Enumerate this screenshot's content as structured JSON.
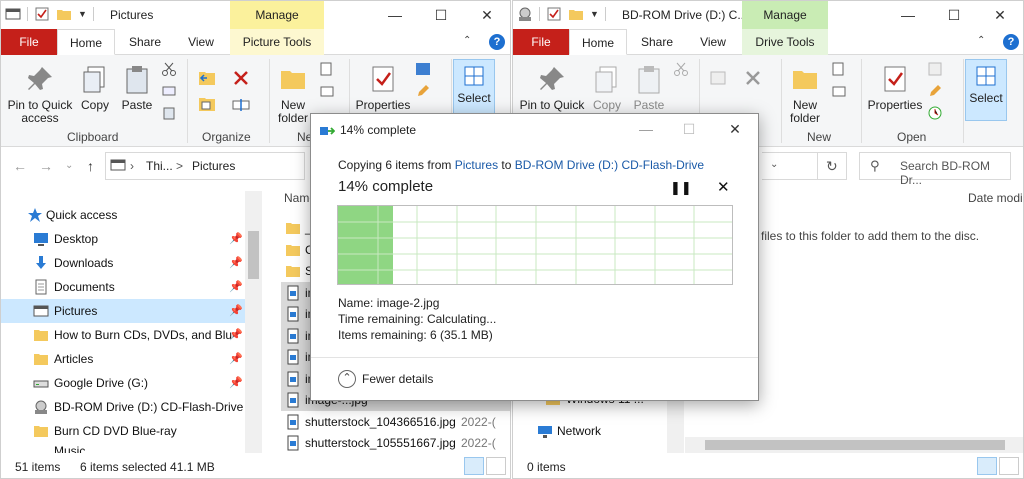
{
  "left_window": {
    "title": "Pictures",
    "context_header": "Manage",
    "tabs": [
      "File",
      "Home",
      "Share",
      "View",
      "Picture Tools"
    ],
    "ribbon": {
      "pin": "Pin to Quick access",
      "copy": "Copy",
      "paste": "Paste",
      "new_folder": "New folder",
      "properties": "Properties",
      "select": "Select",
      "group_clipboard": "Clipboard",
      "group_organize": "Organize",
      "group_new": "Ne"
    },
    "address": {
      "seg1": "Thi...",
      "sep": ">",
      "seg2": "Pictures"
    },
    "nav_items": [
      {
        "label": "Quick access",
        "icon": "star-icon"
      },
      {
        "label": "Desktop",
        "icon": "desktop-icon",
        "pin": true
      },
      {
        "label": "Downloads",
        "icon": "download-icon",
        "pin": true
      },
      {
        "label": "Documents",
        "icon": "documents-icon",
        "pin": true
      },
      {
        "label": "Pictures",
        "icon": "pictures-icon",
        "pin": true,
        "selected": true
      },
      {
        "label": "How to Burn CDs, DVDs, and Blu-",
        "icon": "folder-icon",
        "pin": true
      },
      {
        "label": "Articles",
        "icon": "folder-icon",
        "pin": true
      },
      {
        "label": "Google Drive (G:)",
        "icon": "drive-icon",
        "pin": true
      },
      {
        "label": "BD-ROM Drive (D:) CD-Flash-Drive",
        "icon": "disc-drive-icon"
      },
      {
        "label": "Burn CD DVD Blue-ray",
        "icon": "folder-icon"
      },
      {
        "label": "Music",
        "icon": "music-icon"
      }
    ],
    "file_header": "Name",
    "files": [
      {
        "name": "_",
        "type": "folder"
      },
      {
        "name": "C",
        "type": "folder"
      },
      {
        "name": "S",
        "type": "folder"
      },
      {
        "name": "im",
        "type": "image",
        "selected": true
      },
      {
        "name": "im",
        "type": "image",
        "selected": true
      },
      {
        "name": "im",
        "type": "image",
        "selected": true
      },
      {
        "name": "im",
        "type": "image",
        "selected": true
      },
      {
        "name": "im",
        "type": "image",
        "selected": true
      },
      {
        "name": "image-...jpg",
        "type": "image",
        "selected": true
      },
      {
        "name": "shutterstock_104366516.jpg",
        "date": "2022-(",
        "type": "image"
      },
      {
        "name": "shutterstock_105551667.jpg",
        "date": "2022-(",
        "type": "image"
      }
    ],
    "status": {
      "count": "51 items",
      "selected": "6 items selected  41.1 MB"
    }
  },
  "right_window": {
    "title": "BD-ROM Drive (D:) C...",
    "context_header": "Manage",
    "tabs": [
      "File",
      "Home",
      "Share",
      "View",
      "Drive Tools"
    ],
    "ribbon": {
      "pin": "Pin to Quick access",
      "copy": "Copy",
      "paste": "Paste",
      "new_folder": "New folder",
      "properties": "Properties",
      "select": "Select",
      "group_new": "New",
      "group_open": "Open"
    },
    "search_placeholder": "Search BD-ROM Dr...",
    "column_header": "Date modi",
    "drop_hint": "files to this folder to add them to the disc.",
    "nav_items": [
      {
        "label": "Windows 11 ...",
        "icon": "folder-icon"
      },
      {
        "label": "Network",
        "icon": "network-icon"
      }
    ],
    "status": {
      "count": "0 items"
    }
  },
  "dialog": {
    "title": "14% complete",
    "copy_prefix": "Copying 6 items from",
    "source": "Pictures",
    "to": "to",
    "destination": "BD-ROM Drive (D:) CD-Flash-Drive",
    "heading": "14% complete",
    "progress": 0.14,
    "name_label": "Name:",
    "name_value": "image-2.jpg",
    "time_label": "Time remaining:",
    "time_value": "Calculating...",
    "items_label": "Items remaining:",
    "items_value": "6 (35.1 MB)",
    "fewer_details": "Fewer details"
  },
  "colors": {
    "file_tab": "#c5201a",
    "manage_left": "#fbf19c",
    "manage_right": "#c9ecb4",
    "progress_fill": "#8fd683",
    "selection": "#cce8ff",
    "link": "#1a5aa8"
  }
}
